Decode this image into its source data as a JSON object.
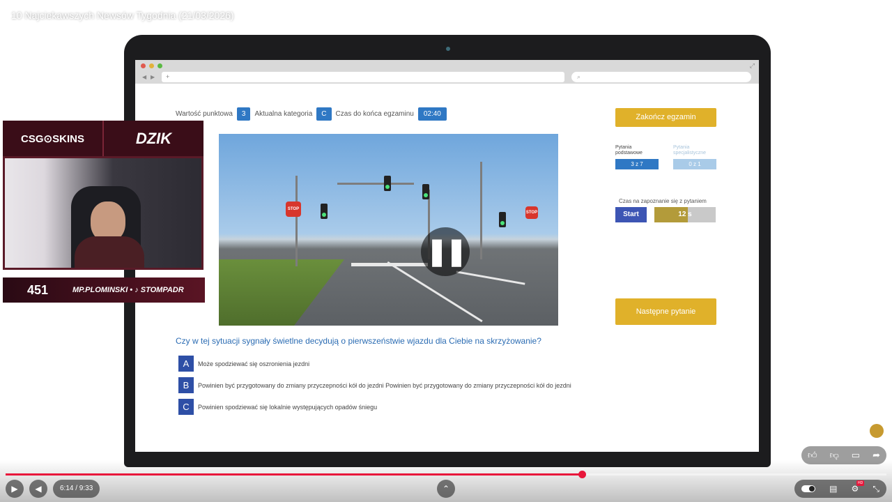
{
  "video": {
    "title": "10 Najciekawszych Newsów Tygodnia (21/03/2026)",
    "time_display": "6:14 / 9:33",
    "progress_fraction": 0.654,
    "accent_color": "#e8173b"
  },
  "browser": {
    "url_placeholder": "",
    "search_placeholder": "",
    "back_icon": "arrow-left-icon",
    "forward_icon": "arrow-right-icon"
  },
  "exam": {
    "points_label": "Wartość punktowa",
    "points_value": "3",
    "category_label": "Aktualna kategoria",
    "category_value": "C",
    "time_label": "Czas do końca egzaminu",
    "time_value": "02:40",
    "finish_button": "Zakończ egzamin",
    "basic_label": "Pytania podstawowe",
    "basic_value": "3 z 7",
    "specialist_label": "Pytania specjalistyczne",
    "specialist_value": "0 z 1",
    "read_time_label": "Czas na zapoznanie się z pytaniem",
    "start_button": "Start",
    "read_time_value": "12 s",
    "read_time_fraction": 0.55,
    "next_button": "Następne pytanie",
    "question": "Czy w tej sytuacji sygnały świetlne decydują o pierwszeństwie wjazdu dla Ciebie na skrzyżowanie?",
    "answers": [
      {
        "letter": "A",
        "text": "Może spodziewać się oszronienia jezdni"
      },
      {
        "letter": "B",
        "text": "Powinien być przygotowany do zmiany przyczepności kół do jezdni Powinien być przygotowany do zmiany przyczepności kół do jezdni"
      },
      {
        "letter": "C",
        "text": "Powinien spodziewać się lokalnie występujących opadów śniegu"
      }
    ],
    "colors": {
      "primary": "#2f78c4",
      "yellow": "#e0b12a",
      "answer": "#2e4fa6"
    }
  },
  "overlay": {
    "sponsor_1": "CSG⊙SKINS",
    "sponsor_2": "DZIK",
    "viewer_count": "451",
    "handle": "MP.PLOMINSKI • ♪ STOMPADR"
  }
}
